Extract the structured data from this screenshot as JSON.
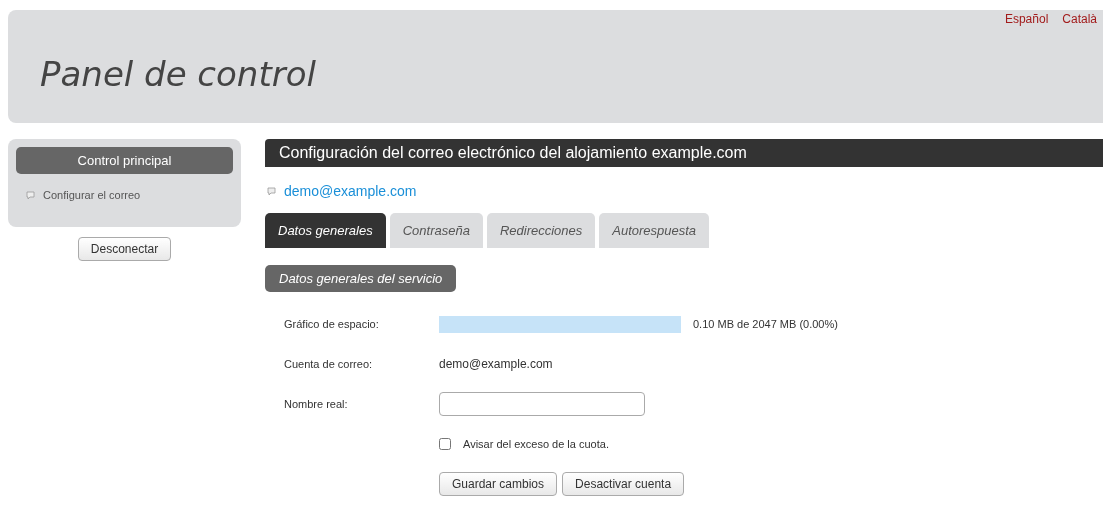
{
  "languages": [
    {
      "label": "Español"
    },
    {
      "label": "Català"
    }
  ],
  "header": {
    "title": "Panel de control"
  },
  "sidebar": {
    "title": "Control principal",
    "items": [
      {
        "label": "Configurar el correo"
      }
    ],
    "logout": "Desconectar"
  },
  "main": {
    "title": "Configuración del correo electrónico del alojamiento example.com",
    "account_link": "demo@example.com",
    "tabs": [
      {
        "label": "Datos generales",
        "selected": true
      },
      {
        "label": "Contraseña",
        "selected": false
      },
      {
        "label": "Redirecciones",
        "selected": false
      },
      {
        "label": "Autorespuesta",
        "selected": false
      }
    ],
    "section": "Datos generales del servicio",
    "space": {
      "label": "Gráfico de espacio:",
      "reading": "0.10 MB de 2047 MB (0.00%)"
    },
    "account": {
      "label": "Cuenta de correo:",
      "value": "demo@example.com"
    },
    "real_name": {
      "label": "Nombre real:"
    },
    "quota_warning": {
      "label": "Avisar del exceso de la cuota.",
      "checked": false
    },
    "buttons": [
      "Guardar cambios",
      "Desactivar cuenta"
    ]
  }
}
